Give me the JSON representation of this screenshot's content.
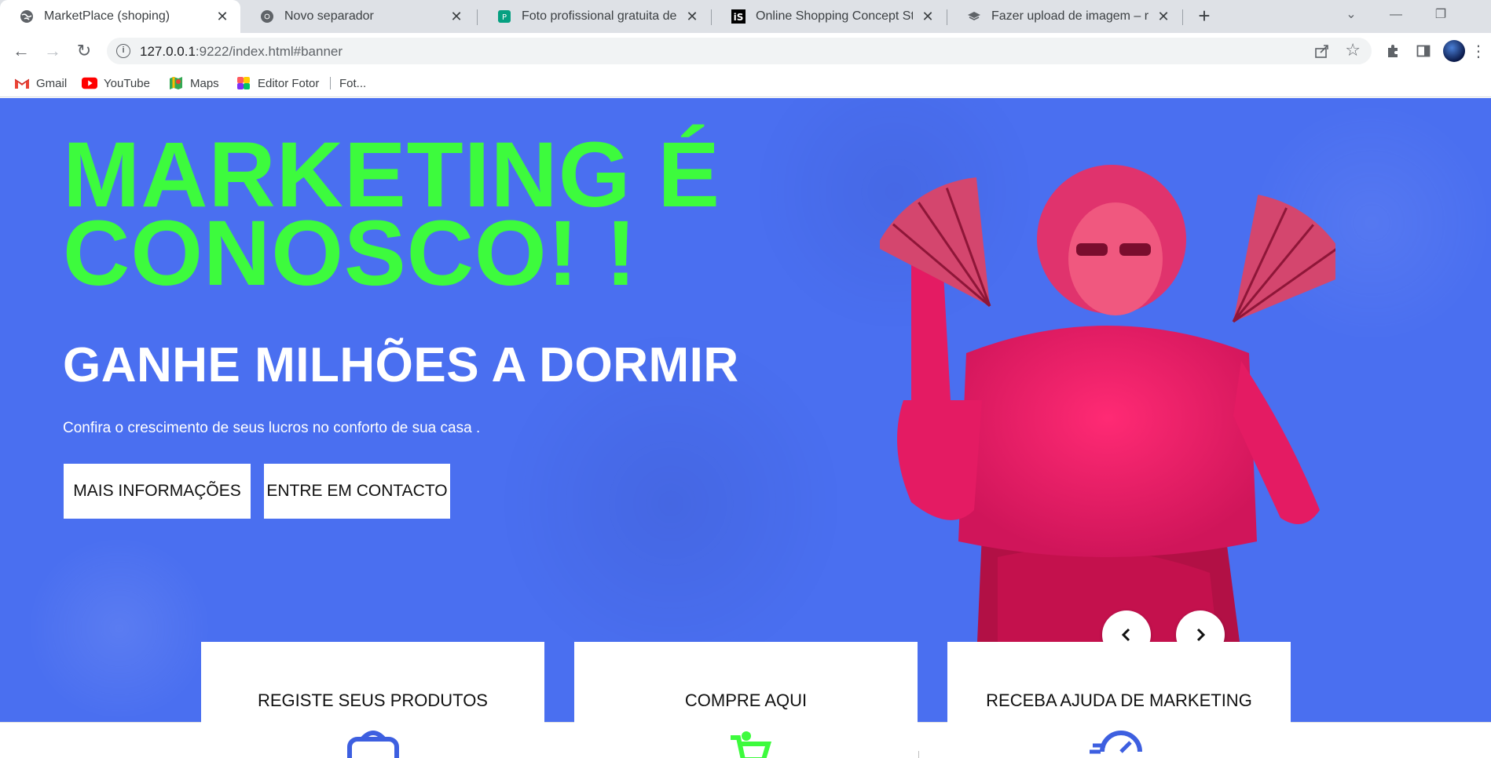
{
  "browser": {
    "tabs": [
      {
        "title": "MarketPlace (shoping)",
        "icon": "globe-icon",
        "active": true
      },
      {
        "title": "Novo separador",
        "icon": "chrome-icon",
        "active": false
      },
      {
        "title": "Foto profissional gratuita de [obj",
        "icon": "pexels-icon",
        "active": false
      },
      {
        "title": "Online Shopping Concept Stock I",
        "icon": "istock-icon",
        "active": false
      },
      {
        "title": "Fazer upload de imagem – remov",
        "icon": "upload-icon",
        "active": false
      }
    ],
    "url_host": "127.0.0.1",
    "url_rest": ":9222/index.html#banner",
    "bookmarks": [
      {
        "label": "Gmail",
        "icon": "gmail-icon"
      },
      {
        "label": "YouTube",
        "icon": "youtube-icon"
      },
      {
        "label": "Maps",
        "icon": "maps-icon"
      },
      {
        "label": "Editor Fotor",
        "icon": "fotor-icon"
      },
      {
        "label": "Fot...",
        "icon": ""
      }
    ]
  },
  "hero": {
    "headline_line1": "MARKETING É",
    "headline_line2": "CONOSCO! !",
    "subheadline": "GANHE MILHÕES A DORMIR",
    "tagline": "Confira o crescimento de seus lucros no conforto de sua casa .",
    "buttons": {
      "more_info": "MAIS INFORMAÇÕES",
      "contact": "ENTRE EM CONTACTO"
    }
  },
  "cards": [
    {
      "title": "REGISTE SEUS PRODUTOS",
      "icon": "bag-icon",
      "icon_color": "#3d5fe0"
    },
    {
      "title": "COMPRE AQUI",
      "icon": "cart-icon",
      "icon_color": "#3dfb3d"
    },
    {
      "title": "RECEBA AJUDA DE MARKETING",
      "icon": "speed-icon",
      "icon_color": "#3d5fe0"
    }
  ],
  "colors": {
    "hero_bg": "#4a6ff0",
    "headline": "#3dfb3d",
    "subhead": "#ffffff"
  }
}
